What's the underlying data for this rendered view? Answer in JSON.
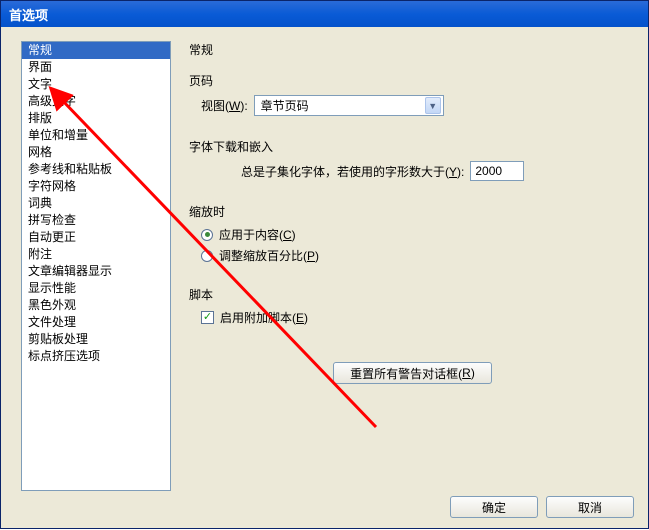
{
  "window": {
    "title": "首选项"
  },
  "sidebar": {
    "items": [
      {
        "label": "常规",
        "selected": true
      },
      {
        "label": "界面"
      },
      {
        "label": "文字"
      },
      {
        "label": "高级文字"
      },
      {
        "label": "排版"
      },
      {
        "label": "单位和增量"
      },
      {
        "label": "网格"
      },
      {
        "label": "参考线和粘贴板"
      },
      {
        "label": "字符网格"
      },
      {
        "label": "词典"
      },
      {
        "label": "拼写检查"
      },
      {
        "label": "自动更正"
      },
      {
        "label": "附注"
      },
      {
        "label": "文章编辑器显示"
      },
      {
        "label": "显示性能"
      },
      {
        "label": "黑色外观"
      },
      {
        "label": "文件处理"
      },
      {
        "label": "剪贴板处理"
      },
      {
        "label": "标点挤压选项"
      }
    ]
  },
  "main": {
    "heading": "常规",
    "page_numbers": {
      "title": "页码",
      "view_label_pre": "视图(",
      "view_label_key": "W",
      "view_label_post": "):",
      "view_value": "章节页码"
    },
    "font_embed": {
      "title": "字体下载和嵌入",
      "label_pre": "总是子集化字体，若使用的字形数大于(",
      "label_key": "Y",
      "label_post": "):",
      "value": "2000"
    },
    "scaling": {
      "title": "缩放时",
      "opt1_pre": "应用于内容(",
      "opt1_key": "C",
      "opt1_post": ")",
      "opt2_pre": "调整缩放百分比(",
      "opt2_key": "P",
      "opt2_post": ")",
      "selected": 0
    },
    "scripts": {
      "title": "脚本",
      "label_pre": "启用附加脚本(",
      "label_key": "E",
      "label_post": ")",
      "checked": true
    },
    "reset_pre": "重置所有警告对话框(",
    "reset_key": "R",
    "reset_post": ")"
  },
  "footer": {
    "ok": "确定",
    "cancel": "取消"
  }
}
